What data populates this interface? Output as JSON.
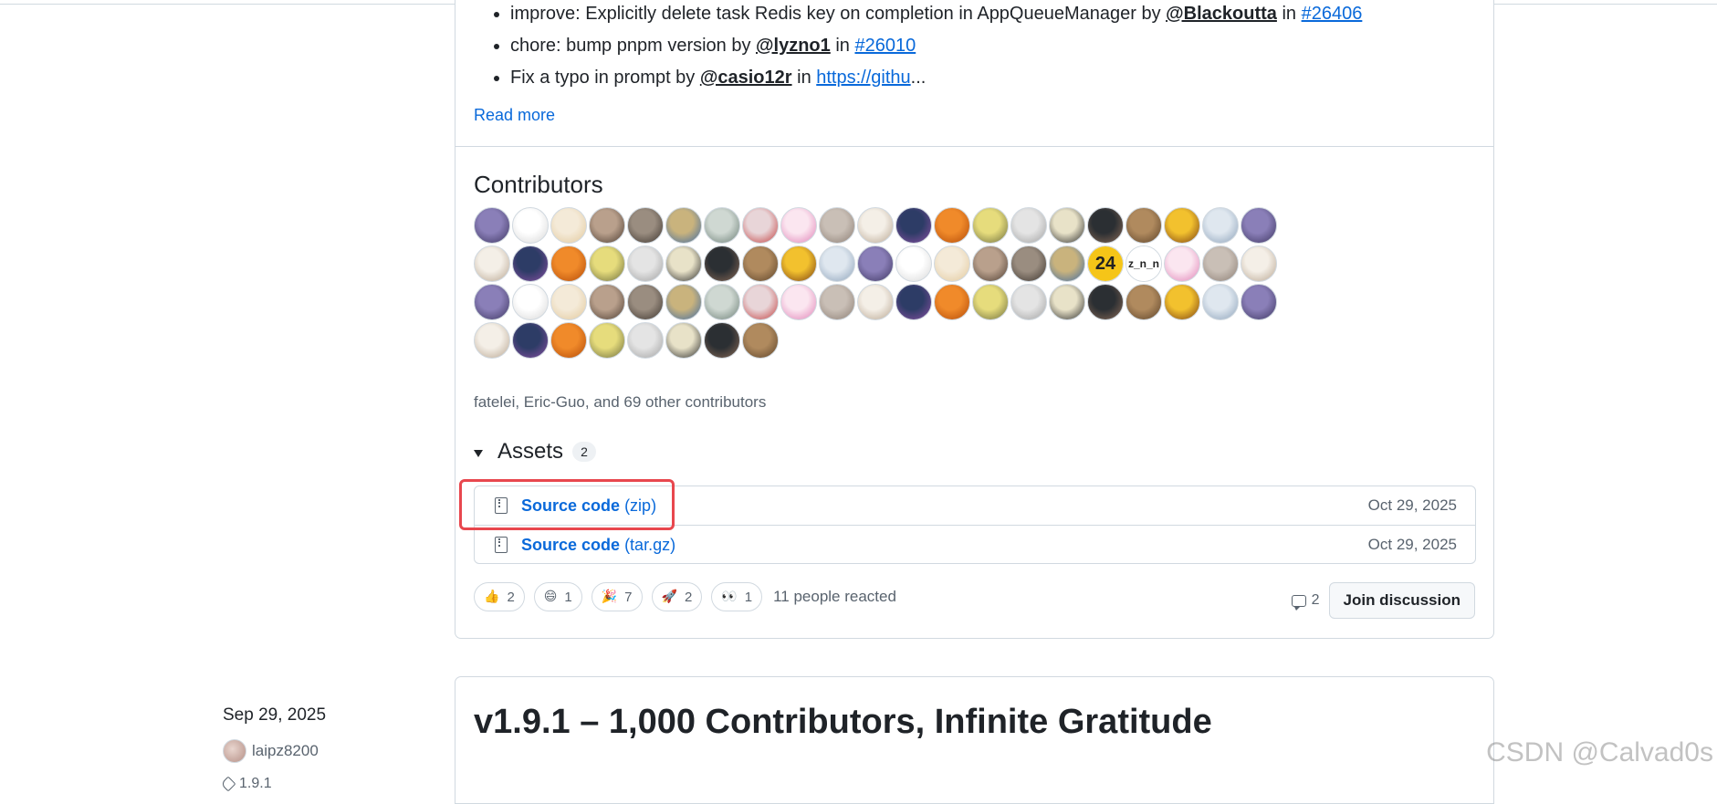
{
  "notes": [
    {
      "text": "improve: Explicitly delete task Redis key on completion in AppQueueManager by ",
      "user": "@Blackoutta",
      "join": " in ",
      "ref": "#26406",
      "tail": ""
    },
    {
      "text": "chore: bump pnpm version by ",
      "user": "@lyzno1",
      "join": " in ",
      "ref": "#26010",
      "tail": ""
    },
    {
      "text": "Fix a typo in prompt by ",
      "user": "@casio12r",
      "join": " in ",
      "ref": "https://githu",
      "tail": "..."
    }
  ],
  "read_more": "Read more",
  "contributors": {
    "title": "Contributors",
    "summary": "fatelei, Eric-Guo, and 69 other contributors",
    "avatar_count": 71,
    "inline_texts": {
      "37": "24",
      "38": "z_n_n"
    }
  },
  "assets": {
    "title": "Assets",
    "count": "2",
    "items": [
      {
        "name": "Source code",
        "ext": "(zip)",
        "date": "Oct 29, 2025"
      },
      {
        "name": "Source code",
        "ext": "(tar.gz)",
        "date": "Oct 29, 2025"
      }
    ]
  },
  "reactions": {
    "items": [
      {
        "icon": "thumbs-up-icon",
        "emoji": "👍",
        "count": "2"
      },
      {
        "icon": "laugh-icon",
        "emoji": "😄",
        "count": "1"
      },
      {
        "icon": "hooray-icon",
        "emoji": "🎉",
        "count": "7"
      },
      {
        "icon": "rocket-icon",
        "emoji": "🚀",
        "count": "2"
      },
      {
        "icon": "eyes-icon",
        "emoji": "👀",
        "count": "1"
      }
    ],
    "summary": "11 people reacted"
  },
  "discussion": {
    "comment_count": "2",
    "button": "Join discussion"
  },
  "next_release": {
    "date": "Sep 29, 2025",
    "author": "laipz8200",
    "tag": "1.9.1",
    "title": "v1.9.1 – 1,000 Contributors, Infinite Gratitude"
  },
  "watermark": "CSDN @Calvad0s",
  "colors": {
    "link": "#0969da",
    "highlight": "#e8474e",
    "border": "#d1d9e0",
    "muted": "#59636e"
  }
}
